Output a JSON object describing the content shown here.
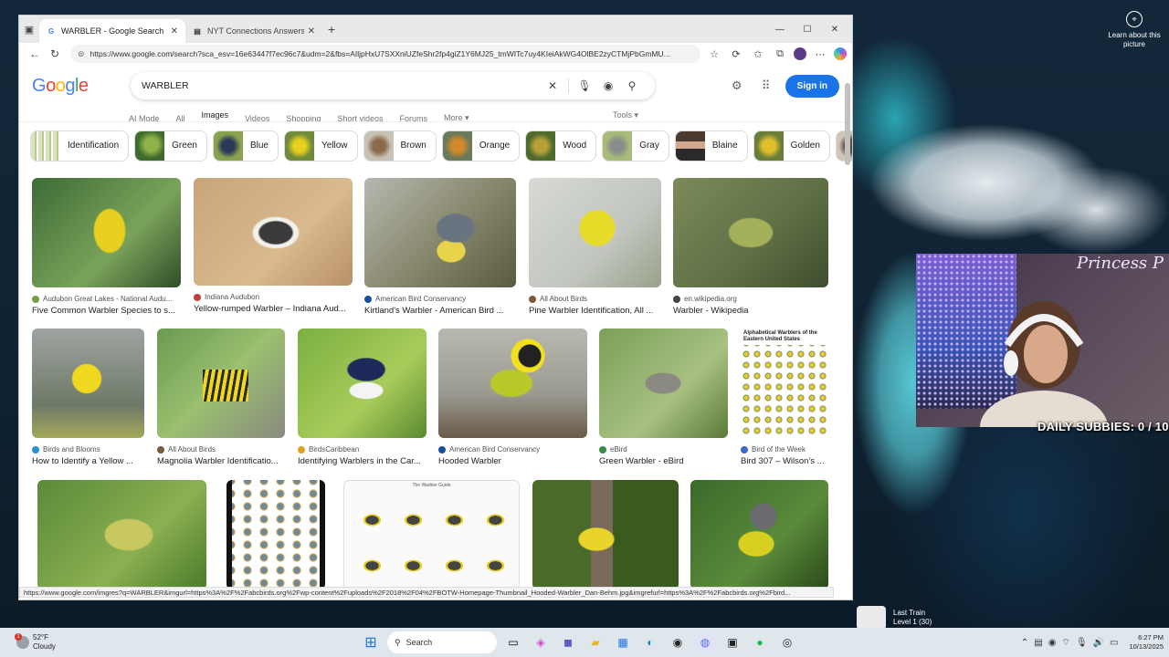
{
  "browser": {
    "tabs": [
      {
        "title": "WARBLER - Google Search",
        "active": true
      },
      {
        "title": "NYT Connections Answers for Oct",
        "active": false
      }
    ],
    "url": "https://www.google.com/search?sca_esv=16e63447f7ec96c7&udm=2&fbs=AIljpHxU7SXXniUZfeShr2fp4giZ1Y6MJ25_tmWITc7uy4KIeiAkWG4OlBE2zyCTMjPbGmMU..."
  },
  "google": {
    "logo": "Google",
    "query": "WARBLER",
    "sign_in": "Sign in",
    "tabs": [
      "AI Mode",
      "All",
      "Images",
      "Videos",
      "Shopping",
      "Short videos",
      "Forums",
      "More ▾"
    ],
    "tools": "Tools ▾",
    "chips": [
      "Identification",
      "Green",
      "Blue",
      "Yellow",
      "Brown",
      "Orange",
      "Wood",
      "Gray",
      "Blaine",
      "Golden"
    ],
    "rows": [
      [
        {
          "source": "Audubon Great Lakes - National Audu...",
          "title": "Five Common Warbler Species to s..."
        },
        {
          "source": "Indiana Audubon",
          "title": "Yellow-rumped Warbler – Indiana Aud..."
        },
        {
          "source": "American Bird Conservancy",
          "title": "Kirtland's Warbler - American Bird ..."
        },
        {
          "source": "All About Birds",
          "title": "Pine Warbler Identification, All ..."
        },
        {
          "source": "en.wikipedia.org",
          "title": "Warbler - Wikipedia"
        }
      ],
      [
        {
          "source": "Birds and Blooms",
          "title": "How to Identify a Yellow ..."
        },
        {
          "source": "All About Birds",
          "title": "Magnolia Warbler Identificatio..."
        },
        {
          "source": "BirdsCaribbean",
          "title": "Identifying Warblers in the Car..."
        },
        {
          "source": "American Bird Conservancy",
          "title": "Hooded Warbler"
        },
        {
          "source": "eBird",
          "title": "Green Warbler - eBird"
        },
        {
          "source": "Bird of the Week",
          "title": "Bird 307 – Wilson's ..."
        }
      ]
    ],
    "chart_poster_title": "Alphabetical Warblers of the Eastern United States",
    "guide_title": "The Warbler Guide",
    "status_url": "https://www.google.com/imgres?q=WARBLER&imgurl=https%3A%2F%2Fabcbirds.org%2Fwp-content%2Fuploads%2F2018%2F04%2FBOTW-Homepage-Thumbnail_Hooded-Warbler_Dan-Behm.jpg&imgrefurl=https%3A%2F%2Fabcbirds.org%2Fbird..."
  },
  "overlay": {
    "learn_about": "Learn about this picture",
    "cam_title": "Princess P",
    "subbies": "DAILY SUBBIES:  0 / 10",
    "game_title": "Last Train",
    "game_level": "Level 1 (30)"
  },
  "taskbar": {
    "temp": "52°F",
    "condition": "Cloudy",
    "search": "Search",
    "time": "6:27 PM",
    "date": "10/13/2025"
  }
}
